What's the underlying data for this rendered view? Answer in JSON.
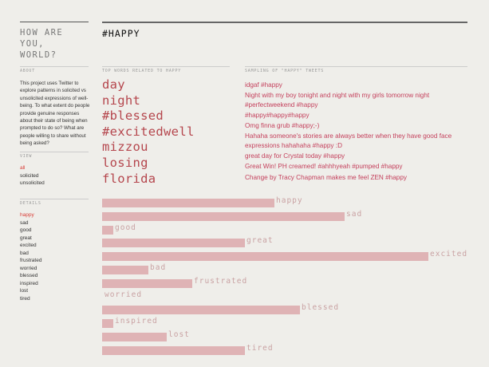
{
  "header": {
    "title_line1": "HOW ARE YOU,",
    "title_line2": "WORLD?",
    "mood": "#HAPPY"
  },
  "about": {
    "heading": "ABOUT",
    "text": "This project uses Twitter to explore patterns in solicited vs unsolicited expressions of well-being. To what extent do people provide genuine responses about their state of being when prompted to do so? What are people willing to share without being asked?"
  },
  "view": {
    "heading": "VIEW",
    "items": [
      "all",
      "solicited",
      "unsolicited"
    ],
    "selected": "all"
  },
  "details": {
    "heading": "DETAILS",
    "items": [
      "happy",
      "sad",
      "good",
      "great",
      "excited",
      "bad",
      "frustrated",
      "worried",
      "blessed",
      "inspired",
      "lost",
      "tired"
    ],
    "selected": "happy"
  },
  "words": {
    "heading": "TOP WORDS RELATED TO HAPPY",
    "items": [
      "day",
      "night",
      "#blessed",
      "#excitedwell",
      "mizzou",
      "losing",
      "florida"
    ]
  },
  "tweets": {
    "heading": "SAMPLING OF \"HAPPY\" TWEETS",
    "items": [
      "idgaf #happy",
      "Night with my boy tonight and night with my girls tomorrow night #perfectweekend #happy",
      "#happy#happy#happy",
      "Omg finna grub #happy;-)",
      "Hahaha someone's stories are always better when they have good face expressions hahahaha #happy :D",
      "great day for Crystal today #happy",
      "Great Win! PH creamed! #ahhhyeah #pumped #happy",
      "Change by Tracy Chapman makes me feel ZEN #happy"
    ]
  },
  "bars": {
    "max": 100,
    "items": [
      {
        "label": "happy",
        "value": 47
      },
      {
        "label": "sad",
        "value": 66
      },
      {
        "label": "good",
        "value": 3
      },
      {
        "label": "great",
        "value": 39
      },
      {
        "label": "excited",
        "value": 89
      },
      {
        "label": "bad",
        "value": 12.5
      },
      {
        "label": "frustrated",
        "value": 24.5
      },
      {
        "label": "worried",
        "value": 0
      },
      {
        "label": "blessed",
        "value": 54
      },
      {
        "label": "inspired",
        "value": 3
      },
      {
        "label": "lost",
        "value": 17.5
      },
      {
        "label": "tired",
        "value": 39
      }
    ]
  },
  "colors": {
    "accent": "#d9403a",
    "tweet": "#c4405c",
    "word": "#b5464d",
    "bar": "#dfb3b5"
  }
}
